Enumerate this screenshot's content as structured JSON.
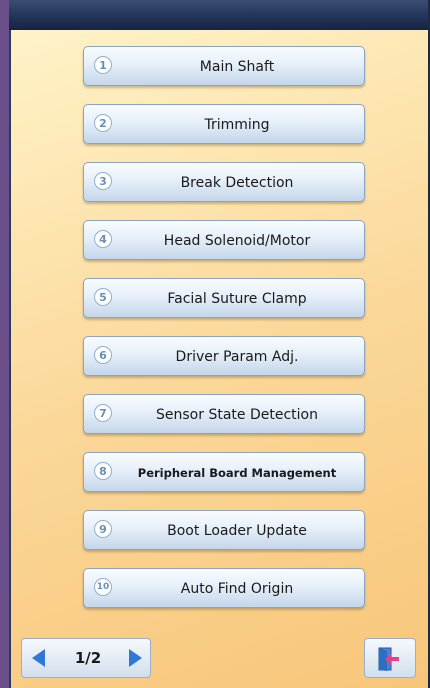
{
  "menu": {
    "items": [
      {
        "num": "1",
        "label": "Main Shaft"
      },
      {
        "num": "2",
        "label": "Trimming"
      },
      {
        "num": "3",
        "label": "Break Detection"
      },
      {
        "num": "4",
        "label": "Head Solenoid/Motor"
      },
      {
        "num": "5",
        "label": "Facial Suture Clamp"
      },
      {
        "num": "6",
        "label": "Driver Param Adj."
      },
      {
        "num": "7",
        "label": "Sensor State Detection"
      },
      {
        "num": "8",
        "label": "Peripheral Board Management"
      },
      {
        "num": "9",
        "label": "Boot Loader Update"
      },
      {
        "num": "10",
        "label": "Auto Find Origin"
      }
    ]
  },
  "pager": {
    "page_text": "1/2",
    "prev_icon": "left-arrow-icon",
    "next_icon": "right-arrow-icon"
  },
  "exit": {
    "icon": "exit-door-icon"
  },
  "colors": {
    "panel": "#f8c67a",
    "button": "#e6eff9",
    "accent": "#2f78d6",
    "exit_arrow": "#e2418c"
  }
}
